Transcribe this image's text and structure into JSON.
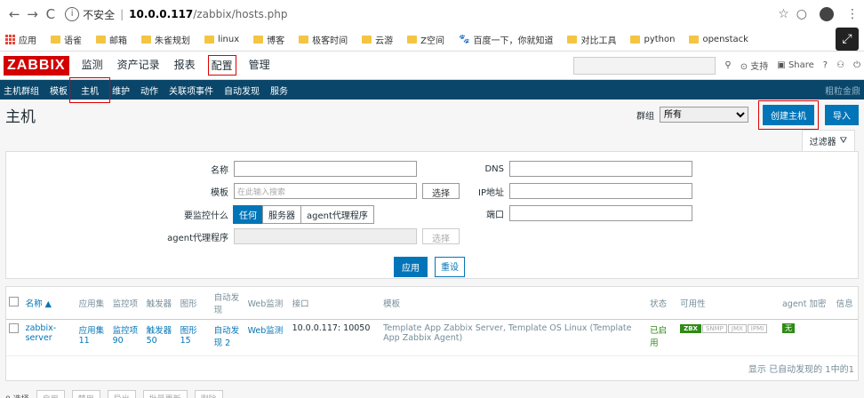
{
  "browser": {
    "back": "←",
    "forward": "→",
    "reload": "C",
    "info_icon": "i",
    "insecure": "不安全",
    "host": "10.0.0.117",
    "path": "/zabbix/hosts.php",
    "star": "☆",
    "ext": "○",
    "menu": "⋮",
    "avatar": "●"
  },
  "bookmarks": [
    {
      "label": "应用",
      "type": "apps"
    },
    {
      "label": "语雀",
      "type": "folder"
    },
    {
      "label": "邮箱",
      "type": "folder"
    },
    {
      "label": "朱雀规划",
      "type": "folder"
    },
    {
      "label": "linux",
      "type": "folder"
    },
    {
      "label": "博客",
      "type": "folder"
    },
    {
      "label": "极客时间",
      "type": "folder"
    },
    {
      "label": "云游",
      "type": "folder"
    },
    {
      "label": "Z空间",
      "type": "folder"
    },
    {
      "label": "百度一下，你就知道",
      "type": "paw"
    },
    {
      "label": "对比工具",
      "type": "folder"
    },
    {
      "label": "python",
      "type": "folder"
    },
    {
      "label": "openstack",
      "type": "folder"
    }
  ],
  "zabbix": {
    "logo": "ZABBIX",
    "menu": [
      "监测",
      "资产记录",
      "报表",
      "配置",
      "管理"
    ],
    "active_menu": "配置",
    "top_right": {
      "support": "支持",
      "share": "Share",
      "help": "?",
      "user": "⚇",
      "logout": "⏻"
    },
    "submenu": [
      "主机群组",
      "模板",
      "主机",
      "维护",
      "动作",
      "关联项事件",
      "自动发现",
      "服务"
    ],
    "active_sub": "主机",
    "submenu_right": "粗粒金鼎"
  },
  "page": {
    "title": "主机",
    "group_label": "群组",
    "group_value": "所有",
    "create_btn": "创建主机",
    "import_btn": "导入"
  },
  "filter": {
    "tab_label": "过滤器",
    "name_label": "名称",
    "template_label": "模板",
    "template_placeholder": "在此输入搜索",
    "select_btn": "选择",
    "monitored_label": "要监控什么",
    "monitored_options": [
      "任何",
      "服务器",
      "agent代理程序"
    ],
    "proxy_label": "agent代理程序",
    "proxy_select": "选择",
    "dns_label": "DNS",
    "ip_label": "IP地址",
    "port_label": "端口",
    "apply": "应用",
    "reset": "重设"
  },
  "table": {
    "headers": [
      "名称 ▲",
      "应用集",
      "监控项",
      "触发器",
      "图形",
      "自动发现",
      "Web监测",
      "接口",
      "模板",
      "状态",
      "可用性",
      "agent 加密",
      "信息"
    ],
    "rows": [
      {
        "name": "zabbix-server",
        "apps": "应用集 11",
        "items": "监控项 90",
        "triggers": "触发器 50",
        "graphs": "图形 15",
        "discovery": "自动发现 2",
        "web": "Web监测",
        "iface": "10.0.0.117: 10050",
        "templates": "Template App Zabbix Server, Template OS Linux (Template App Zabbix Agent)",
        "status": "已启用",
        "avail": [
          "ZBX",
          "SNMP",
          "JMX",
          "IPMI"
        ],
        "encrypt": "无"
      }
    ],
    "footer": "显示 已自动发现的 1中的1"
  },
  "actions": {
    "selected": "0 选择",
    "buttons": [
      "启用",
      "禁用",
      "导出",
      "批量更新",
      "删除"
    ]
  }
}
